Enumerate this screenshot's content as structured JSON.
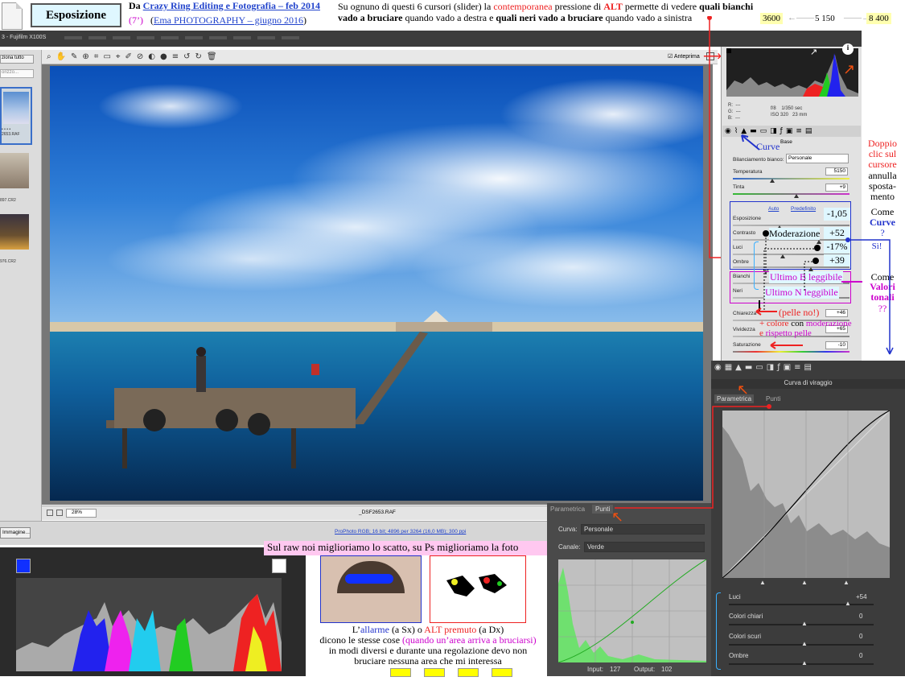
{
  "header": {
    "title": "Esposizione",
    "source_prefix": "Da",
    "source_link": "Crazy Ring Editing e Fotografia – feb 2014",
    "duration": "(7’)",
    "source2_link": "Ema PHOTOGRAPHY – giugno 2016",
    "source2_open": "(",
    "source2_close": ")",
    "desc_1": "Su ognuno di questi 6 cursori (slider) la ",
    "desc_contemp": "contemporanea",
    "desc_2": " pressione di ",
    "desc_alt": "ALT",
    "desc_3": " permette di vedere ",
    "desc_white": "quali bianchi vado a bruciare",
    "desc_4": " quando vado a destra e ",
    "desc_black": "quali neri vado a bruciare",
    "desc_5": " quando vado a sinistra",
    "temp_min": "3600",
    "temp_mid": "5 150",
    "temp_max": "8 400"
  },
  "app": {
    "window_title": "3 - Fujifilm X100S",
    "open_all": "ziona tutto",
    "sort": "orizzo...",
    "preview_label": "Anteprima",
    "zoom": "28%",
    "filename": "_DSF2653.RAF",
    "info_link": "ProPhoto RGB; 16 bit; 4896 per 3264 (16,0 MB); 300 ppi",
    "open_image": "Immagine...",
    "film1": "2653.RAF",
    "film2": "897.CR2",
    "film3": "976.CR2",
    "film_dots": "• • • •"
  },
  "acr": {
    "rgb_r": "R:",
    "rgb_g": "G:",
    "rgb_b": "B:",
    "rgb_dash": "---",
    "aperture": "f/8",
    "shutter": "1/350 sec",
    "iso": "ISO 320",
    "focal": "23 mm",
    "base_tab": "Base",
    "wb_label": "Bilanciamento bianco:",
    "wb_value": "Personale",
    "temp_label": "Temperatura",
    "temp_value": "5150",
    "tint_label": "Tinta",
    "tint_value": "+9",
    "auto": "Auto",
    "default": "Predefinito",
    "exposure_label": "Esposizione",
    "exposure_value": "-1,05",
    "contrast_label": "Contrasto",
    "contrast_value": "+52",
    "highlights_label": "Luci",
    "highlights_value": "-17%",
    "shadows_label": "Ombre",
    "shadows_value": "+39",
    "whites_label": "Bianchi",
    "blacks_label": "Neri",
    "clarity_label": "Chiarezza",
    "clarity_value": "+46",
    "vibrance_label": "Vividezza",
    "vibrance_value": "+65",
    "saturation_label": "Saturazione",
    "saturation_value": "-10"
  },
  "curve": {
    "title": "Curva di viraggio",
    "tab_param": "Parametrica",
    "tab_points": "Punti",
    "luci": "Luci",
    "luci_val": "+54",
    "chiari": "Colori chiari",
    "chiari_val": "0",
    "scuri": "Colori scuri",
    "scuri_val": "0",
    "ombre": "Ombre",
    "ombre_val": "0"
  },
  "points": {
    "tab_param": "Parametrica",
    "tab_points": "Punti",
    "curve_label": "Curva:",
    "curve_value": "Personale",
    "channel_label": "Canale:",
    "channel_value": "Verde",
    "input_label": "Input:",
    "input_value": "127",
    "output_label": "Output:",
    "output_value": "102"
  },
  "annotations": {
    "curve_word": "Curve",
    "doppio": "Doppio clic sul cursore",
    "annulla": "annulla sposta-mento",
    "come": "Come",
    "curve_q": "Curve",
    "qmark": "?",
    "si": "Sì!",
    "come2": "Come",
    "valori": "Valori tonali",
    "qq": "??",
    "moderazione": "Moderazione",
    "ultimo_b": "Ultimo B leggibile",
    "ultimo_n": "Ultimo N leggibile",
    "pelle_no": "(pelle no!)",
    "colore_pre": "+ colore",
    "colore_mid": " con ",
    "colore_mod": "moderazione",
    "rispetto_pre": "e ",
    "rispetto": "rispetto pelle",
    "raw_vs_ps": "Sul raw noi miglioriamo lo scatto, su Ps miglioriamo la foto",
    "allarme_pre": "L’",
    "allarme": "allarme",
    "allarme_sx": " (a Sx)   o ",
    "alt_premuto": "ALT premuto",
    "alt_dx": " (a Dx)",
    "dicono_1": "dicono le stesse cose ",
    "dicono_q": "(quando un’area arriva a bruciarsi)",
    "dicono_2": " in modi diversi e durante una regolazione devo non bruciare nessuna area che mi interessa"
  },
  "colors": {
    "accent_red": "#ee2211",
    "accent_blue": "#2233cc",
    "accent_magenta": "#cc00cc",
    "cyan_box": "#dff7ff"
  }
}
